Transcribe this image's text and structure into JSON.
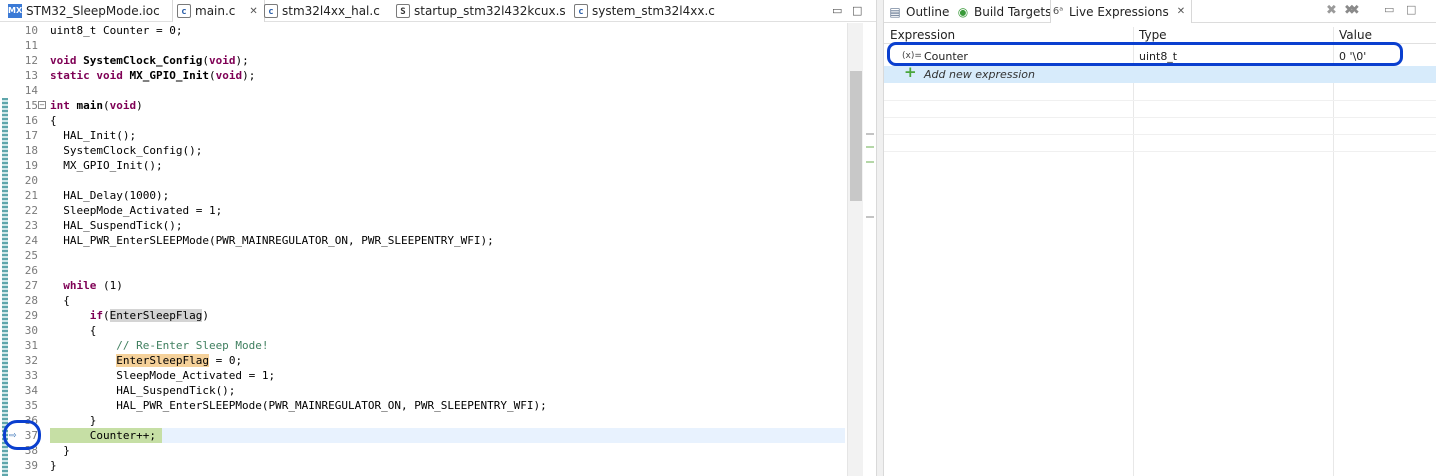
{
  "editor": {
    "tabs": [
      {
        "icon": "MX",
        "label": "STM32_SleepMode.ioc",
        "active": false
      },
      {
        "icon": "c",
        "label": "main.c",
        "close": "✕",
        "active": true
      },
      {
        "icon": "c",
        "label": "stm32l4xx_hal.c",
        "active": false
      },
      {
        "icon": "S",
        "label": "startup_stm32l432kcux.s",
        "active": false
      },
      {
        "icon": "c",
        "label": "system_stm32l4xx.c",
        "active": false
      }
    ],
    "window_controls": {
      "minimize": "▭",
      "maximize": "□"
    },
    "lines": [
      {
        "num": "10",
        "text": "uint8_t Counter = 0;"
      },
      {
        "num": "11",
        "text": ""
      },
      {
        "num": "12",
        "text": "void SystemClock_Config(void);"
      },
      {
        "num": "13",
        "text": "static void MX_GPIO_Init(void);"
      },
      {
        "num": "14",
        "text": ""
      },
      {
        "num": "15",
        "text": "int main(void)"
      },
      {
        "num": "16",
        "text": "{"
      },
      {
        "num": "17",
        "text": "  HAL_Init();"
      },
      {
        "num": "18",
        "text": "  SystemClock_Config();"
      },
      {
        "num": "19",
        "text": "  MX_GPIO_Init();"
      },
      {
        "num": "20",
        "text": ""
      },
      {
        "num": "21",
        "text": "  HAL_Delay(1000);"
      },
      {
        "num": "22",
        "text": "  SleepMode_Activated = 1;"
      },
      {
        "num": "23",
        "text": "  HAL_SuspendTick();"
      },
      {
        "num": "24",
        "text": "  HAL_PWR_EnterSLEEPMode(PWR_MAINREGULATOR_ON, PWR_SLEEPENTRY_WFI);"
      },
      {
        "num": "25",
        "text": ""
      },
      {
        "num": "26",
        "text": ""
      },
      {
        "num": "27",
        "text": "  while (1)"
      },
      {
        "num": "28",
        "text": "  {"
      },
      {
        "num": "29",
        "text": "      if(EnterSleepFlag)"
      },
      {
        "num": "30",
        "text": "      {"
      },
      {
        "num": "31",
        "text": "          // Re-Enter Sleep Mode!"
      },
      {
        "num": "32",
        "text": "          EnterSleepFlag = 0;"
      },
      {
        "num": "33",
        "text": "          SleepMode_Activated = 1;"
      },
      {
        "num": "34",
        "text": "          HAL_SuspendTick();"
      },
      {
        "num": "35",
        "text": "          HAL_PWR_EnterSLEEPMode(PWR_MAINREGULATOR_ON, PWR_SLEEPENTRY_WFI);"
      },
      {
        "num": "36",
        "text": "      }"
      },
      {
        "num": "37",
        "text": "      Counter++;"
      },
      {
        "num": "38",
        "text": "  }"
      },
      {
        "num": "39",
        "text": "}"
      }
    ],
    "current_line": "37",
    "fold_marker": "−",
    "ip_arrow": "⇨"
  },
  "views": {
    "tabs": [
      {
        "icon": "outline-icon",
        "glyph": "▤",
        "label": "Outline",
        "active": false
      },
      {
        "icon": "build-targets-icon",
        "glyph": "◉",
        "label": "Build Targets",
        "active": false
      },
      {
        "icon": "live-expressions-icon",
        "glyph": "6ᵃ",
        "label": "Live Expressions",
        "close": "✕",
        "active": true
      }
    ],
    "toolbar": {
      "remove": "✖",
      "remove_all": "✖✖",
      "minimize": "▭",
      "maximize": "□"
    },
    "columns": [
      "Expression",
      "Type",
      "Value"
    ],
    "rows": [
      {
        "icon_text": "(x)=",
        "expression": "Counter",
        "type": "uint8_t",
        "value": "0 '\\0'"
      }
    ],
    "add_new": {
      "icon": "+",
      "label": "Add new expression"
    }
  },
  "colors": {
    "keyword": "#7f0055",
    "comment": "#3f7f5f",
    "annotation_circle": "#0a3fcf",
    "current_line_bg": "#e8f2fe",
    "selection_row": "#d7ebfb"
  }
}
